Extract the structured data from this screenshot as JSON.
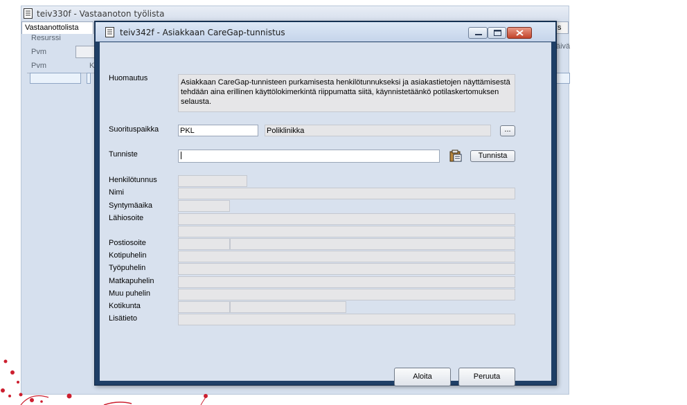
{
  "background_window": {
    "title": "teiv330f - Vastaanoton työlista",
    "tab": "Vastaanottolista",
    "tab_right": "s",
    "resurssi_label": "Resurssi",
    "pvm_label_1": "Pvm",
    "pvm_label_2": "Pvm",
    "col_k": "K",
    "side_text": "äivä"
  },
  "dialog": {
    "title": "teiv342f - Asiakkaan CareGap-tunnistus",
    "huomautus_label": "Huomautus",
    "huomautus_text": "Asiakkaan CareGap-tunnisteen purkamisesta henkilötunnukseksi ja asiakastietojen näyttämisestä tehdään aina erillinen käyttölokimerkintä riippumatta siitä, käynnistetäänkö potilaskertomuksen selausta.",
    "suorituspaikka_label": "Suorituspaikka",
    "suorituspaikka_code": "PKL",
    "suorituspaikka_name": "Poliklinikka",
    "browse_label": "...",
    "tunniste_label": "Tunniste",
    "tunniste_value": "",
    "tunnista_button": "Tunnista",
    "fields": {
      "henkilotunnus": "Henkilötunnus",
      "nimi": "Nimi",
      "syntymaaika": "Syntymäaika",
      "lahiosoite": "Lähiosoite",
      "postiosoite": "Postiosoite",
      "kotipuhelin": "Kotipuhelin",
      "tyopuhelin": "Työpuhelin",
      "matkapuhelin": "Matkapuhelin",
      "muu_puhelin": "Muu puhelin",
      "kotikunta": "Kotikunta",
      "lisatieto": "Lisätieto"
    },
    "aloita_button": "Aloita",
    "peruuta_button": "Peruuta"
  },
  "icons": {
    "window_icon": "document-icon",
    "clipboard": "clipboard-paste-icon",
    "minimize": "minimize-icon",
    "maximize": "maximize-icon",
    "close": "close-icon"
  },
  "colors": {
    "dialog_frame": "#1f3f66",
    "dialog_body": "#d8e1ee",
    "close_button": "#c2432b",
    "decoration": "#cc1f2f"
  }
}
